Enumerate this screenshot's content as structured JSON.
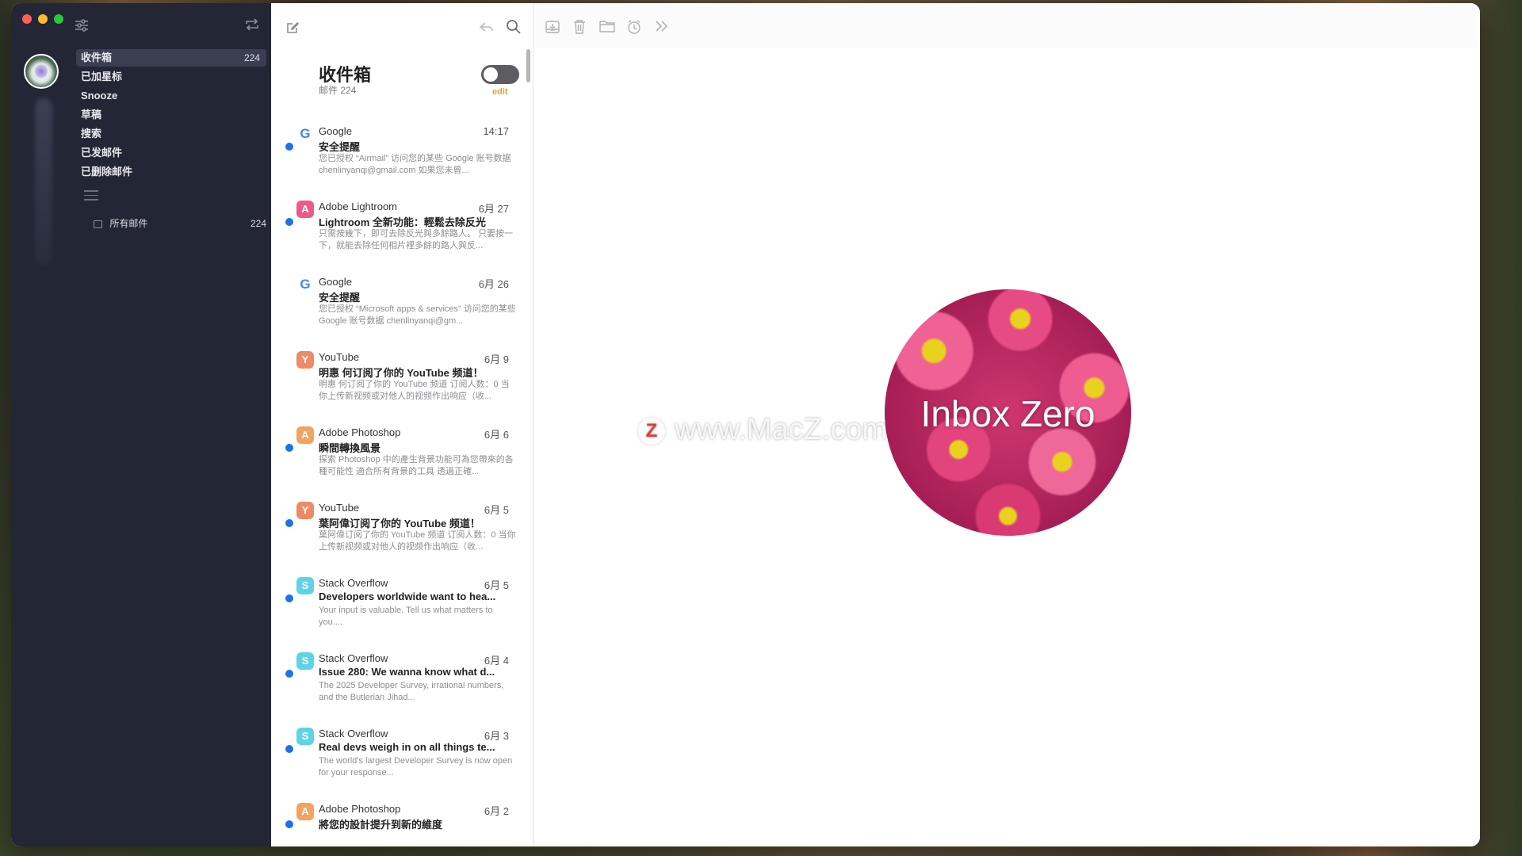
{
  "sidebar": {
    "folders": [
      {
        "label": "收件箱",
        "count": "224"
      },
      {
        "label": "已加星标",
        "count": ""
      },
      {
        "label": "Snooze",
        "count": ""
      },
      {
        "label": "草稿",
        "count": ""
      },
      {
        "label": "搜索",
        "count": ""
      },
      {
        "label": "已发邮件",
        "count": ""
      },
      {
        "label": "已删除邮件",
        "count": ""
      }
    ],
    "all_mail": {
      "label": "所有邮件",
      "count": "224"
    }
  },
  "list": {
    "title": "收件箱",
    "subtitle": "邮件 224",
    "edit_label": "edit",
    "messages": [
      {
        "sender": "Google",
        "icon": "G",
        "time": "14:17",
        "subject": "安全提醒",
        "preview": "您已授权 “Airmail” 访问您的某些 Google 账号数据 chenlinyanqi@gmail.com 如果您未曾...",
        "unread": true
      },
      {
        "sender": "Adobe Lightroom",
        "icon": "A",
        "time": "6月 27",
        "subject": "Lightroom 全新功能：輕鬆去除反光",
        "preview": "只需按幾下，即可去除反光與多餘路人。 只要按一下，就能去除任何相片裡多餘的路人與反...",
        "unread": true
      },
      {
        "sender": "Google",
        "icon": "G",
        "time": "6月 26",
        "subject": "安全提醒",
        "preview": "您已授权 “Microsoft apps & services” 访问您的某些 Google 账号数据 chenlinyanqi@gm...",
        "unread": false
      },
      {
        "sender": "YouTube",
        "icon": "Y",
        "time": "6月 9",
        "subject": "明惠 何订阅了你的 YouTube 频道！",
        "preview": "明惠 何订阅了你的 YouTube 频道 订阅人数：0 当你上传新视频或对他人的视频作出响应（收...",
        "unread": false
      },
      {
        "sender": "Adobe Photoshop",
        "icon": "A",
        "time": "6月 6",
        "subject": "瞬間轉換風景",
        "preview": "探索 Photoshop 中的產生背景功能可為您帶來的各種可能性 適合所有背景的工具 透過正確...",
        "unread": true
      },
      {
        "sender": "YouTube",
        "icon": "Y",
        "time": "6月 5",
        "subject": "葉阿偉订阅了你的 YouTube 频道！",
        "preview": "葉阿偉订阅了你的 YouTube 频道 订阅人数：0 当你上传新视频或对他人的视频作出响应（收...",
        "unread": true
      },
      {
        "sender": "Stack Overflow",
        "icon": "S",
        "time": "6月 5",
        "subject": "Developers worldwide want to hea...",
        "preview": "Your input is valuable. Tell us what matters to you....",
        "unread": true
      },
      {
        "sender": "Stack Overflow",
        "icon": "S",
        "time": "6月 4",
        "subject": "Issue 280: We wanna know what d...",
        "preview": "The 2025 Developer Survey, irrational numbers, and the Butlerian Jihad...",
        "unread": true
      },
      {
        "sender": "Stack Overflow",
        "icon": "S",
        "time": "6月 3",
        "subject": "Real devs weigh in on all things te...",
        "preview": "The world's largest Developer Survey is now open for your response...",
        "unread": true
      },
      {
        "sender": "Adobe Photoshop",
        "icon": "A",
        "time": "6月 2",
        "subject": "將您的設計提升到新的維度",
        "preview": "",
        "unread": true
      }
    ]
  },
  "pane": {
    "empty_state": "Inbox Zero",
    "watermark": "www.MacZ.com",
    "watermark_logo": "Z"
  },
  "colors": {
    "sidebar_bg": "#232634",
    "unread_dot": "#1a73e8",
    "edit_accent": "#e2a133",
    "adobe_lightroom": "#ea5b88",
    "adobe_photoshop": "#f2a35d",
    "youtube": "#ee8a65",
    "stackoverflow": "#5fd3e6"
  }
}
